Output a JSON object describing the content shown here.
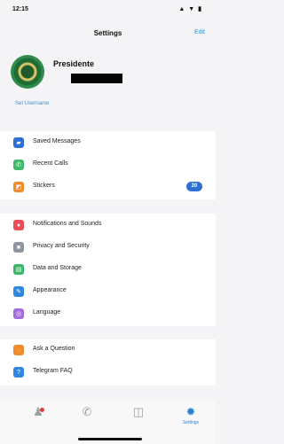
{
  "status_bar": {
    "time": "12:15",
    "icons": "▲ ▼ ▮"
  },
  "nav": {
    "title": "Settings",
    "edit_label": "Edit"
  },
  "profile": {
    "name": "Presidente",
    "set_username_label": "Set Username"
  },
  "menu_groups": [
    {
      "items": [
        {
          "label": "Saved Messages",
          "icon": "bookmark-icon",
          "icon_glyph": "▰",
          "color": "#2e6fd3"
        },
        {
          "label": "Recent Calls",
          "icon": "phone-icon",
          "icon_glyph": "✆",
          "color": "#41b96a"
        },
        {
          "label": "Stickers",
          "icon": "sticker-icon",
          "icon_glyph": "◩",
          "color": "#f08a2b",
          "badge": "20"
        }
      ]
    },
    {
      "items": [
        {
          "label": "Notifications and Sounds",
          "icon": "bell-icon",
          "icon_glyph": "●",
          "color": "#ea4d57"
        },
        {
          "label": "Privacy and Security",
          "icon": "lock-icon",
          "icon_glyph": "■",
          "color": "#8f96a0"
        },
        {
          "label": "Data and Storage",
          "icon": "storage-icon",
          "icon_glyph": "▤",
          "color": "#3cb66a"
        },
        {
          "label": "Appearance",
          "icon": "brush-icon",
          "icon_glyph": "✎",
          "color": "#2f87df"
        },
        {
          "label": "Language",
          "icon": "globe-icon",
          "icon_glyph": "◎",
          "color": "#a46ddc"
        }
      ]
    },
    {
      "items": [
        {
          "label": "Ask a Question",
          "icon": "chat-icon",
          "icon_glyph": "◌",
          "color": "#f08a2b"
        },
        {
          "label": "Telegram FAQ",
          "icon": "question-icon",
          "icon_glyph": "?",
          "color": "#2f87df"
        }
      ]
    }
  ],
  "tab_bar": {
    "tabs": [
      {
        "icon": "contacts-icon",
        "glyph": "♟",
        "label": "",
        "badge_dot": true
      },
      {
        "icon": "calls-icon",
        "glyph": "✆",
        "label": ""
      },
      {
        "icon": "chats-icon",
        "glyph": "◫",
        "label": ""
      },
      {
        "icon": "settings-icon",
        "glyph": "✹",
        "label": "Settings",
        "active": true
      }
    ]
  },
  "colors": {
    "accent": "#3d8fd6",
    "badge": "#2f6fd1",
    "background": "#f4f4f6"
  }
}
